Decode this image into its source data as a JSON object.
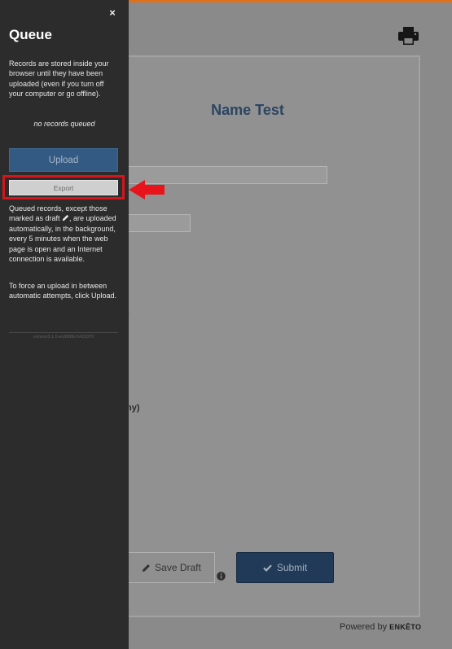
{
  "queue_panel": {
    "close_label": "×",
    "title": "Queue",
    "intro_text": "Records are stored inside your browser until they have been uploaded (even if you turn off your computer or go offline).",
    "empty_state": "no records queued",
    "upload_label": "Upload",
    "export_label": "Export",
    "explain_before_icon": "Queued records, except those marked as draft",
    "explain_after_icon": ", are uploaded automatically, in the background, every 5 minutes when the web page is open and an Internet connection is available.",
    "force_text": "To force an upload in between automatic attempts, click Upload.",
    "version_text": "version3.1.0-ecdf98b-5415070"
  },
  "form": {
    "title": "Name Test",
    "fragment_1": ")",
    "fragment_2": "ny)",
    "save_draft_label": "Save Draft",
    "submit_label": "Submit"
  },
  "footer": {
    "powered_by": "Powered by",
    "brand": "ENKĒTO"
  },
  "colors": {
    "accent_orange": "#e0701a",
    "panel_bg": "#2c2c2c",
    "upload_blue": "#335a82",
    "highlight_red": "#d5151b"
  },
  "icons": [
    "close-icon",
    "print-icon",
    "pencil-icon",
    "info-icon",
    "check-icon",
    "red-arrow-icon"
  ]
}
